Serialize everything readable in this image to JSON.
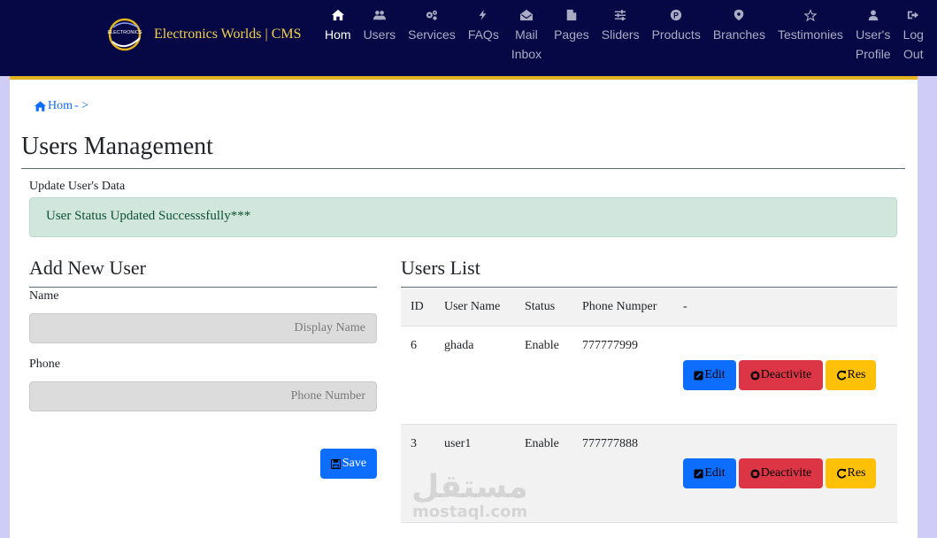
{
  "brand": {
    "name": "Electronics Worlds | CMS",
    "logo_text": "ELECTRONICS"
  },
  "nav": [
    {
      "label": "Hom",
      "icon": "home-icon",
      "active": true
    },
    {
      "label": "Users",
      "icon": "users-icon"
    },
    {
      "label": "Services",
      "icon": "cogs-icon"
    },
    {
      "label": "FAQs",
      "icon": "bolt-icon"
    },
    {
      "label": "Mail\nInbox",
      "icon": "envelope-open-icon"
    },
    {
      "label": "Pages",
      "icon": "file-icon"
    },
    {
      "label": "Sliders",
      "icon": "sliders-icon"
    },
    {
      "label": "Products",
      "icon": "product-icon"
    },
    {
      "label": "Branches",
      "icon": "map-marker-icon"
    },
    {
      "label": "Testimonies",
      "icon": "star-icon"
    },
    {
      "label": "User's\nProfile",
      "icon": "user-icon"
    },
    {
      "label": "Log\nOut",
      "icon": "sign-out-icon"
    }
  ],
  "breadcrumb": {
    "home": "Hom",
    "separator": "- >"
  },
  "page": {
    "title": "Users Management",
    "update_label": "Update User's Data",
    "alert": "User Status Updated Successsfully***"
  },
  "form": {
    "title": "Add New User",
    "name_label": "Name",
    "name_placeholder": "Display Name",
    "phone_label": "Phone",
    "phone_placeholder": "Phone Number",
    "save_label": "Save"
  },
  "users_list": {
    "title": "Users List",
    "headers": [
      "ID",
      "User Name",
      "Status",
      "Phone Numper",
      "-"
    ],
    "rows": [
      {
        "id": "6",
        "name": "ghada",
        "status": "Enable",
        "phone": "777777999"
      },
      {
        "id": "3",
        "name": "user1",
        "status": "Enable",
        "phone": "777777888"
      }
    ],
    "edit_label": "Edit",
    "deactivate_label": "Deactivite",
    "reset_label": "Res"
  },
  "watermark": {
    "arabic": "مستقل",
    "latin": "mostaql.com"
  },
  "colors": {
    "navbar": "#060845",
    "navbar_border": "#e3b41f",
    "page_bg": "#cfcdf7",
    "alert_bg": "#d1e7dd",
    "primary": "#0d6efd",
    "danger": "#dc3545",
    "warning": "#ffc107"
  }
}
